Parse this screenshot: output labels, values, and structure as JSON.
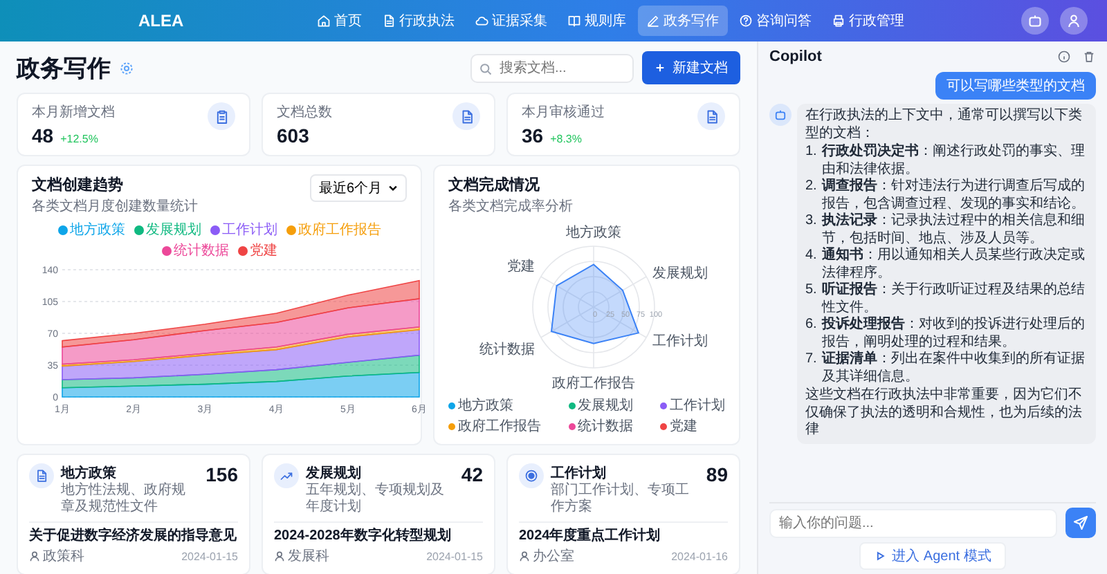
{
  "nav": {
    "logo": "ALEA",
    "items": [
      {
        "label": "首页",
        "selected": false
      },
      {
        "label": "行政执法",
        "selected": false
      },
      {
        "label": "证据采集",
        "selected": false
      },
      {
        "label": "规则库",
        "selected": false
      },
      {
        "label": "政务写作",
        "selected": true
      },
      {
        "label": "咨询问答",
        "selected": false
      },
      {
        "label": "行政管理",
        "selected": false
      }
    ]
  },
  "page": {
    "title": "政务写作",
    "search_placeholder": "搜索文档...",
    "new_button": "新建文档"
  },
  "stats": [
    {
      "label": "本月新增文档",
      "value": "48",
      "change": "+12.5%"
    },
    {
      "label": "文档总数",
      "value": "603"
    },
    {
      "label": "本月审核通过",
      "value": "36",
      "change": "+8.3%"
    }
  ],
  "trend": {
    "title": "文档创建趋势",
    "subtitle": "各类文档月度创建数量统计",
    "period": "最近6个月",
    "chart_data": {
      "type": "area",
      "stacked": true,
      "grid": true,
      "categories": [
        "1月",
        "2月",
        "3月",
        "4月",
        "5月",
        "6月"
      ],
      "ylim": [
        0,
        140
      ],
      "yticks": [
        0,
        35,
        70,
        105,
        140
      ],
      "series": [
        {
          "name": "地方政策",
          "color": "#0ea5e9",
          "values": [
            10,
            12,
            14,
            17,
            23,
            27
          ]
        },
        {
          "name": "发展规划",
          "color": "#10b981",
          "values": [
            9,
            9,
            11,
            13,
            15,
            19
          ]
        },
        {
          "name": "工作计划",
          "color": "#8b5cf6",
          "values": [
            15,
            18,
            21,
            22,
            28,
            28
          ]
        },
        {
          "name": "政府工作报告",
          "color": "#f59e0b",
          "values": [
            2,
            2,
            2,
            3,
            3,
            3
          ]
        },
        {
          "name": "统计数据",
          "color": "#ec4899",
          "values": [
            19,
            22,
            25,
            27,
            29,
            31
          ]
        },
        {
          "name": "党建",
          "color": "#ef4444",
          "values": [
            7,
            7,
            7,
            10,
            14,
            20
          ]
        }
      ]
    }
  },
  "completion": {
    "title": "文档完成情况",
    "subtitle": "各类文档完成率分析",
    "axes": [
      "地方政策",
      "发展规划",
      "工作计划",
      "政府工作报告",
      "统计数据",
      "党建"
    ],
    "ticks": [
      "0",
      "25",
      "50",
      "75",
      "100"
    ],
    "legend": [
      {
        "name": "地方政策",
        "color": "#0ea5e9"
      },
      {
        "name": "发展规划",
        "color": "#10b981"
      },
      {
        "name": "工作计划",
        "color": "#8b5cf6"
      },
      {
        "name": "政府工作报告",
        "color": "#f59e0b"
      },
      {
        "name": "统计数据",
        "color": "#ec4899"
      },
      {
        "name": "党建",
        "color": "#ef4444"
      }
    ]
  },
  "categories": [
    {
      "title": "地方政策",
      "desc": "地方性法规、政府规章及规范性文件",
      "count": "156",
      "doc": {
        "title": "关于促进数字经济发展的指导意见",
        "date": "2024-01-15",
        "dept": "政策科"
      }
    },
    {
      "title": "发展规划",
      "desc": "五年规划、专项规划及年度计划",
      "count": "42",
      "doc": {
        "title": "2024-2028年数字化转型规划",
        "date": "2024-01-15",
        "dept": "发展科"
      }
    },
    {
      "title": "工作计划",
      "desc": "部门工作计划、专项工作方案",
      "count": "89",
      "doc": {
        "title": "2024年度重点工作计划",
        "date": "2024-01-16",
        "dept": "办公室"
      }
    }
  ],
  "copilot": {
    "title": "Copilot",
    "user_message": "可以写哪些类型的文档",
    "reply_intro": "在行政执法的上下文中，通常可以撰写以下类型的文档：",
    "reply_items": [
      {
        "marker": "1.",
        "text": "**行政处罚决定书**：阐述行政处罚的事实、理由和法律依据。"
      },
      {
        "marker": "2.",
        "text": "**调查报告**：针对违法行为进行调查后写成的报告，包含调查过程、发现的事实和结论。"
      },
      {
        "marker": "3.",
        "text": "**执法记录**：记录执法过程中的相关信息和细节，包括时间、地点、涉及人员等。"
      },
      {
        "marker": "4.",
        "text": "**通知书**：用以通知相关人员某些行政决定或法律程序。"
      },
      {
        "marker": "5.",
        "text": "**听证报告**：关于行政听证过程及结果的总结性文件。"
      },
      {
        "marker": "6.",
        "text": "**投诉处理报告**：对收到的投诉进行处理后的报告，阐明处理的过程和结果。"
      },
      {
        "marker": "7.",
        "text": "**证据清单**：列出在案件中收集到的所有证据及其详细信息。"
      }
    ],
    "reply_outro": "这些文档在行政执法中非常重要，因为它们不仅确保了执法的透明和合规性，也为后续的法律",
    "input_placeholder": "输入你的问题...",
    "agent_button": "进入 Agent 模式"
  }
}
